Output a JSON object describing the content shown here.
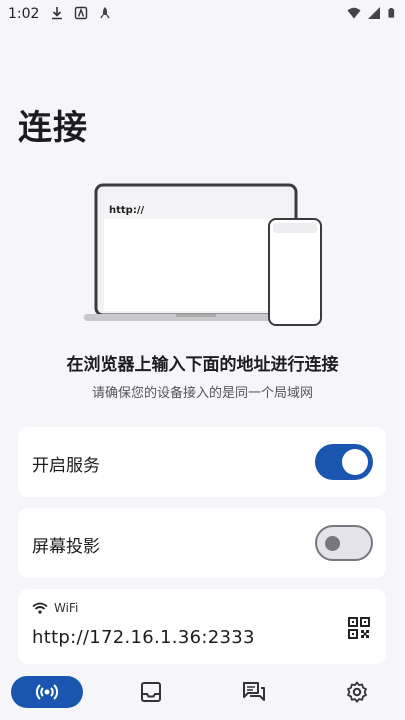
{
  "status_bar": {
    "time": "1:02",
    "left_icons": [
      "download-icon",
      "a-icon",
      "rocket-icon"
    ],
    "right_icons": [
      "wifi-signal-icon",
      "cell-signal-icon",
      "battery-icon"
    ]
  },
  "page": {
    "title": "连接",
    "headline": "在浏览器上输入下面的地址进行连接",
    "subline": "请确保您的设备接入的是同一个局域网"
  },
  "illustration": {
    "browser_address": "http://"
  },
  "service_card": {
    "label": "开启服务",
    "enabled": true
  },
  "screen_card": {
    "label": "屏幕投影",
    "enabled": false
  },
  "wifi_card": {
    "network_type": "WiFi",
    "url": "http://172.16.1.36:2333",
    "qr_icon": "qr-code-icon"
  },
  "bottom_nav": {
    "items": [
      {
        "icon": "connect-icon",
        "active": true
      },
      {
        "icon": "inbox-icon",
        "active": false
      },
      {
        "icon": "chat-icon",
        "active": false
      },
      {
        "icon": "settings-icon",
        "active": false
      }
    ]
  },
  "colors": {
    "accent": "#1a56b0",
    "background": "#f6f5fa",
    "card": "#ffffff"
  }
}
